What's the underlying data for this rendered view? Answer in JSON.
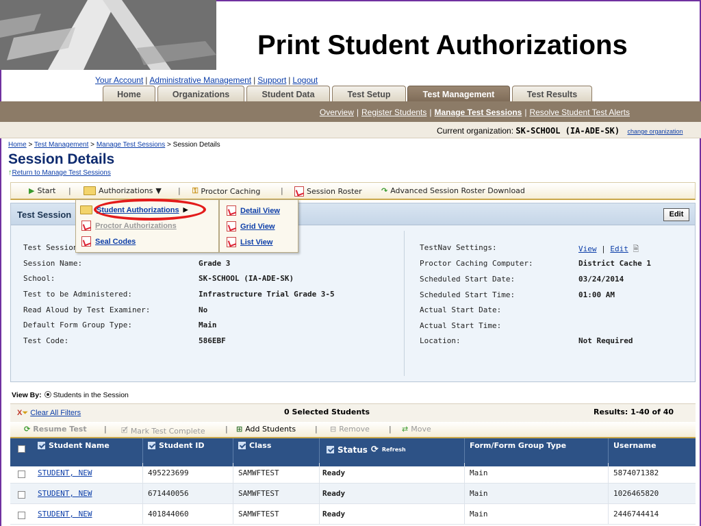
{
  "slide": {
    "title": "Print Student Authorizations"
  },
  "top_links": [
    "Your Account",
    "Administrative Management",
    "Support",
    "Logout"
  ],
  "tabs": [
    {
      "label": "Home"
    },
    {
      "label": "Organizations"
    },
    {
      "label": "Student Data"
    },
    {
      "label": "Test Setup"
    },
    {
      "label": "Test Management",
      "active": true
    },
    {
      "label": "Test Results"
    }
  ],
  "subnav": [
    "Overview",
    "Register Students",
    "Manage Test Sessions",
    "Resolve Student Test Alerts"
  ],
  "org": {
    "label": "Current organization:",
    "value": "SK-SCHOOL (IA-ADE-SK)",
    "change_link": "change organization"
  },
  "breadcrumb": {
    "items": [
      "Home",
      "Test Management",
      "Manage Test Sessions"
    ],
    "current": "Session Details"
  },
  "page": {
    "title": "Session Details",
    "return_link": "Return to Manage Test Sessions"
  },
  "toolbar": {
    "start": "Start",
    "authorizations": "Authorizations",
    "proctor_caching": "Proctor Caching",
    "session_roster": "Session Roster",
    "advanced_roster": "Advanced Session Roster Download"
  },
  "auth_menu": {
    "student_authorizations": "Student Authorizations",
    "proctor_authorizations": "Proctor Authorizations",
    "seal_codes": "Seal Codes"
  },
  "view_menu": {
    "detail": "Detail View",
    "grid": "Grid View",
    "list": "List View"
  },
  "panel": {
    "title": "Test Session",
    "edit": "Edit",
    "left": [
      {
        "label": "Test Session",
        "value": ""
      },
      {
        "label": "Session Name:",
        "value": "Grade 3"
      },
      {
        "label": "School:",
        "value": "SK-SCHOOL (IA-ADE-SK)"
      },
      {
        "label": "Test to be Administered:",
        "value": "Infrastructure Trial Grade 3-5"
      },
      {
        "label": "Read Aloud by Test Examiner:",
        "value": "No"
      },
      {
        "label": "Default Form Group Type:",
        "value": "Main"
      },
      {
        "label": "Test Code:",
        "value": "586EBF"
      }
    ],
    "right": [
      {
        "label": "TestNav Settings:",
        "value": ""
      },
      {
        "label": "Proctor Caching Computer:",
        "value": "District Cache 1"
      },
      {
        "label": "Scheduled Start Date:",
        "value": "03/24/2014"
      },
      {
        "label": "Scheduled Start Time:",
        "value": "01:00 AM"
      },
      {
        "label": "Actual Start Date:",
        "value": ""
      },
      {
        "label": "Actual Start Time:",
        "value": ""
      },
      {
        "label": "Location:",
        "value": "Not Required"
      }
    ],
    "testnav_view": "View",
    "testnav_edit": "Edit"
  },
  "view_by": {
    "label": "View By:",
    "option": "Students in the Session"
  },
  "filters": {
    "clear": "Clear All Filters",
    "selected": "0 Selected Students",
    "results": "Results: 1-40 of 40"
  },
  "actions": {
    "resume": "Resume Test",
    "mark_complete": "Mark Test Complete",
    "add_students": "Add Students",
    "remove": "Remove",
    "move": "Move"
  },
  "table": {
    "headers": [
      "Student Name",
      "Student ID",
      "Class",
      "Status",
      "Form/Form Group Type",
      "Username"
    ],
    "refresh": "Refresh",
    "rows": [
      {
        "name": "STUDENT, NEW",
        "id": "495223699",
        "class": "SAMWFTEST",
        "status": "Ready",
        "form": "Main",
        "username": "5874071382"
      },
      {
        "name": "STUDENT, NEW",
        "id": "671440056",
        "class": "SAMWFTEST",
        "status": "Ready",
        "form": "Main",
        "username": "1026465820"
      },
      {
        "name": "STUDENT, NEW",
        "id": "401844060",
        "class": "SAMWFTEST",
        "status": "Ready",
        "form": "Main",
        "username": "2446744414"
      }
    ]
  },
  "colors": {
    "frame": "#7030a0",
    "navbar": "#8c7b67",
    "table_header": "#2d5286",
    "highlight": "#e31b1b",
    "link": "#0b3da8"
  }
}
